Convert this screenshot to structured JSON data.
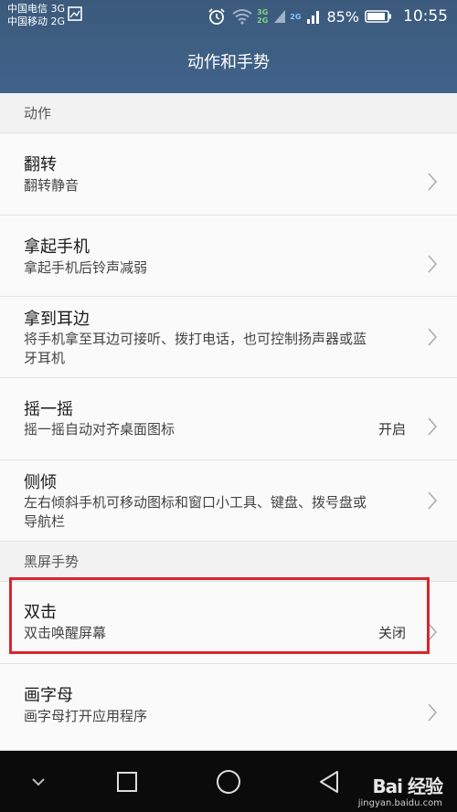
{
  "status_bar": {
    "carrier1": "中国电信 3G",
    "carrier2": "中国移动 2G",
    "net_top": "3G",
    "net_bottom": "2G",
    "net_top2": "2G",
    "battery": "85%",
    "time": "10:55",
    "icons": [
      "image-icon",
      "alarm-icon",
      "wifi-icon",
      "signal-icon",
      "battery-icon"
    ]
  },
  "header": {
    "title": "动作和手势"
  },
  "sections": {
    "motion": "动作",
    "screen_off": "黑屏手势"
  },
  "items": [
    {
      "title": "翻转",
      "subtitle": "翻转静音",
      "value": ""
    },
    {
      "title": "拿起手机",
      "subtitle": "拿起手机后铃声减弱",
      "value": ""
    },
    {
      "title": "拿到耳边",
      "subtitle": "将手机拿至耳边可接听、拨打电话，也可控制扬声器或蓝牙耳机",
      "value": ""
    },
    {
      "title": "摇一摇",
      "subtitle": "摇一摇自动对齐桌面图标",
      "value": "开启"
    },
    {
      "title": "侧倾",
      "subtitle": "左右倾斜手机可移动图标和窗口小工具、键盘、拨号盘或导航栏",
      "value": ""
    },
    {
      "title": "双击",
      "subtitle": "双击唤醒屏幕",
      "value": "关闭"
    },
    {
      "title": "画字母",
      "subtitle": "画字母打开应用程序",
      "value": ""
    }
  ],
  "navbar": {
    "icons": [
      "chevron-down-icon",
      "recent-apps-icon",
      "home-icon",
      "back-icon"
    ]
  },
  "watermark": {
    "brand": "Bai 经验",
    "url": "jingyan.baidu.com"
  },
  "colors": {
    "header": "#41638a",
    "highlight": "#d8262d",
    "navbar": "#0b0b0b"
  }
}
